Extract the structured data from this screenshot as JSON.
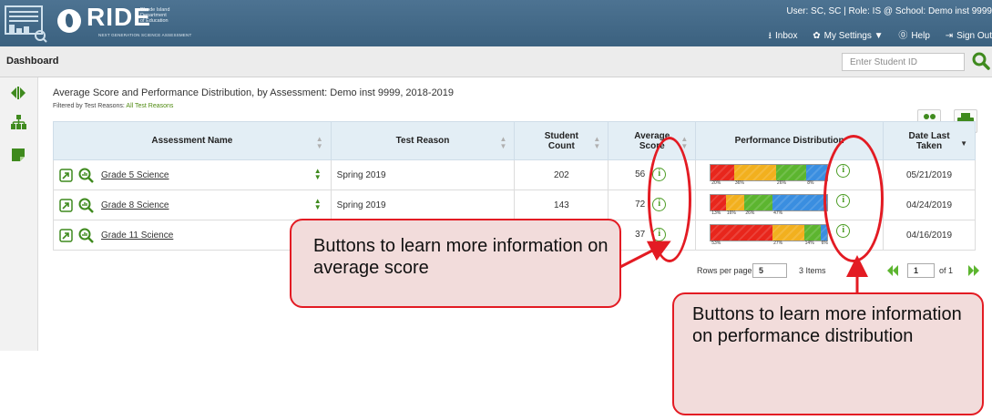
{
  "header": {
    "logo_text": "RIDE",
    "org_lines": [
      "Rhode Island",
      "Department",
      "of Education"
    ],
    "tagline": "NEXT GENERATION SCIENCE ASSESSMENT",
    "user_info": "User: SC, SC  |  Role: IS @ School: Demo inst 9999",
    "links": [
      {
        "label": "Inbox",
        "icon": "download-icon"
      },
      {
        "label": "My Settings ▼",
        "icon": "gear-icon"
      },
      {
        "label": "Help",
        "icon": "help-icon"
      },
      {
        "label": "Sign Out",
        "icon": "sign-out-icon"
      }
    ]
  },
  "dashbar": {
    "title": "Dashboard",
    "student_id_placeholder": "Enter Student ID",
    "search_icon": "search-icon"
  },
  "rail": {
    "icons": [
      "expand-collapse-icon",
      "hierarchy-icon",
      "note-icon"
    ]
  },
  "report": {
    "title": "Average Score and Performance Distribution, by Assessment: Demo inst 9999, 2018-2019",
    "filter_label": "Filtered by Test Reasons:",
    "filter_value": "All Test Reasons",
    "export_icon": "export-icon",
    "print_icon": "print-icon"
  },
  "table": {
    "columns": [
      {
        "label": "Assessment Name"
      },
      {
        "label": "Test Reason"
      },
      {
        "label": "Student",
        "label2": "Count"
      },
      {
        "label": "Average",
        "label2": "Score"
      },
      {
        "label": "Performance Distribution"
      },
      {
        "label": "Date Last",
        "label2": "Taken"
      }
    ],
    "rows": [
      {
        "name": "Grade 5 Science",
        "reason": "Spring 2019",
        "count": "202",
        "score": "56",
        "date": "05/21/2019",
        "dist": [
          20,
          36,
          26,
          18
        ],
        "dist_labels": [
          "20%",
          "36%",
          "26%",
          "8%"
        ]
      },
      {
        "name": "Grade 8 Science",
        "reason": "Spring 2019",
        "count": "143",
        "score": "72",
        "date": "04/24/2019",
        "dist": [
          13,
          16,
          24,
          47
        ],
        "dist_labels": [
          "13%",
          "16%",
          "26%",
          "47%"
        ]
      },
      {
        "name": "Grade 11 Science",
        "reason": "",
        "count": "",
        "score": "37",
        "date": "04/16/2019",
        "dist": [
          53,
          27,
          14,
          6
        ],
        "dist_labels": [
          "53%",
          "27%",
          "14%",
          "6%"
        ]
      }
    ]
  },
  "pagination": {
    "rows_per_page_label": "Rows per page:",
    "rows_per_page_value": "5",
    "items_text": "3 Items",
    "page_value": "1",
    "of_text": "of 1"
  },
  "callouts": {
    "avg_score": "Buttons to learn more information on average score",
    "perf_dist": "Buttons to learn more information on performance distribution"
  },
  "colors": {
    "banner": "#3b617f",
    "level1": "#e8261c",
    "level2": "#f2b01e",
    "level3": "#5cb52f",
    "level4": "#3a8ee0",
    "callout_border": "#e31b23",
    "callout_fill": "#f2dcdb",
    "info_green": "#4d9d25"
  }
}
